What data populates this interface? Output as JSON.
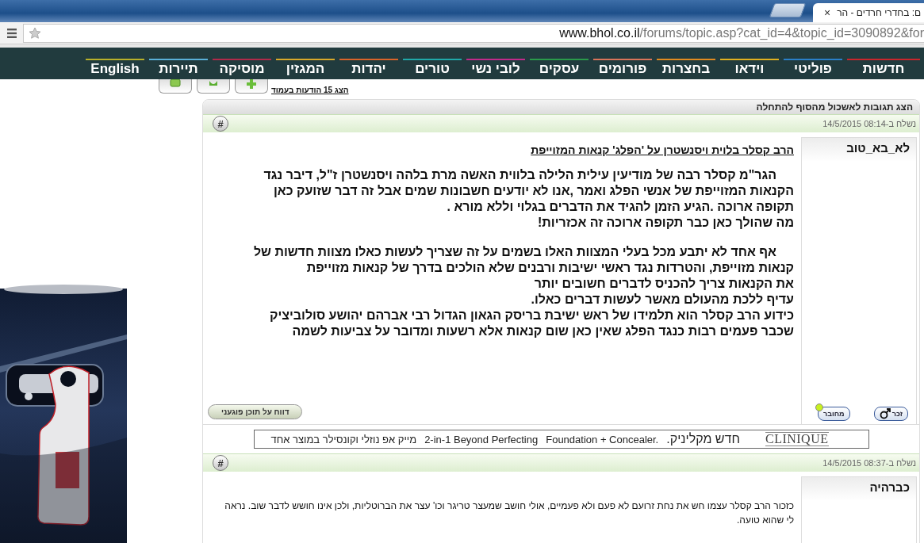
{
  "browser": {
    "tab_title": "ם: בחדרי חרדים - הר",
    "tab_close": "×",
    "url_domain": "www.bhol.co.il",
    "url_path": "/forums/topic.asp?cat_id=4&topic_id=3090892&for"
  },
  "nav": [
    {
      "label": "חדשות",
      "color": "#c8262c"
    },
    {
      "label": "פוליטי",
      "color": "#2a7fc8"
    },
    {
      "label": "וידאו",
      "color": "#e0b020"
    },
    {
      "label": "בחצרות",
      "color": "#e08a20"
    },
    {
      "label": "פורומים",
      "color": "#d8745a"
    },
    {
      "label": "עסקים",
      "color": "#2a9a4a"
    },
    {
      "label": "לובי נשי",
      "color": "#c02a8a"
    },
    {
      "label": "טורים",
      "color": "#20a8a8"
    },
    {
      "label": "יהדות",
      "color": "#d8642a"
    },
    {
      "label": "המגזין",
      "color": "#d8a82a"
    },
    {
      "label": "מוסיקה",
      "color": "#b02a4a"
    },
    {
      "label": "תיירות",
      "color": "#5ab0d8"
    },
    {
      "label": "English",
      "color": "#b8b02a"
    }
  ],
  "toolbar": {
    "page_size_link": "הצג 15 הודעות בעמוד"
  },
  "forum": {
    "sort_header": "הצג תגובות לאשכול מהסוף להתחלה",
    "posts": [
      {
        "hash": "#",
        "date": "נשלח ב-08:14 14/5/2015",
        "author": "לא_בא_טוב",
        "title": "הרב קסלר בלוית ויסנשטרן על 'הפלג' קנאות המזוייפת",
        "kind": "article",
        "paragraphs": [
          [
            "הגר\"מ קסלר רבה של מודיעין עילית הלילה בלווית האשה מרת בלהה ויסנשטרן ז\"ל, דיבר נגד",
            "הקנאות המזוייפת של אנשי הפלג ואמר ,אנו לא יודעים חשבונות שמים אבל זה דבר שזועק כאן",
            "תקופה ארוכה .הגיע הזמן להגיד את הדברים בגלוי וללא מורא .",
            "מה שהולך כאן כבר תקופה ארוכה זה אכזריות!"
          ],
          [
            "אף אחד לא יתבע מכל בעלי המצוות האלו בשמים על זה שצריך לעשות כאלו מצוות חדשות של",
            "קנאות מזוייפת, והטרדות נגד ראשי ישיבות ורבנים שלא הולכים בדרך של קנאות מזוייפת",
            "את הקנאות צריך להכניס לדברים חשובים יותר",
            "עדיף ללכת מהעולם מאשר לעשות דברים כאלו.",
            "כידוע הרב קסלר הוא תלמידו של ראש ישיבת בריסק הגאון הגדול רבי אברהם יהושע סולוביציק",
            "שכבר פעמים רבות כנגד הפלג שאין כאן שום קנאות אלא רשעות ומדובר על צביעות לשמה"
          ]
        ],
        "report_button": "דווח על תוכן פוגעני",
        "gender": "זכר",
        "status": "מחובר",
        "online": true
      },
      {
        "hash": "#",
        "date": "נשלח ב-08:37 14/5/2015",
        "author": "כברהיה",
        "kind": "comment",
        "paragraphs": [
          [
            "כזכור הרב קסלר עצמו חש את נחת זרועם לא פעם ולא פעמיים, אולי חושב שמעצר טריגר וכו' עצר את הברוטליות, ולכן אינו חושש לדבר שוב. נראה לי שהוא טועה."
          ]
        ]
      }
    ],
    "ad_strip": {
      "brand": "CLINIQUE",
      "texts": [
        "חדש מקליניק.",
        "Foundation + Concealer.",
        "2-in-1 Beyond Perfecting",
        "מייק אפ נוזלי וקונסילר במוצר אחד"
      ]
    }
  }
}
